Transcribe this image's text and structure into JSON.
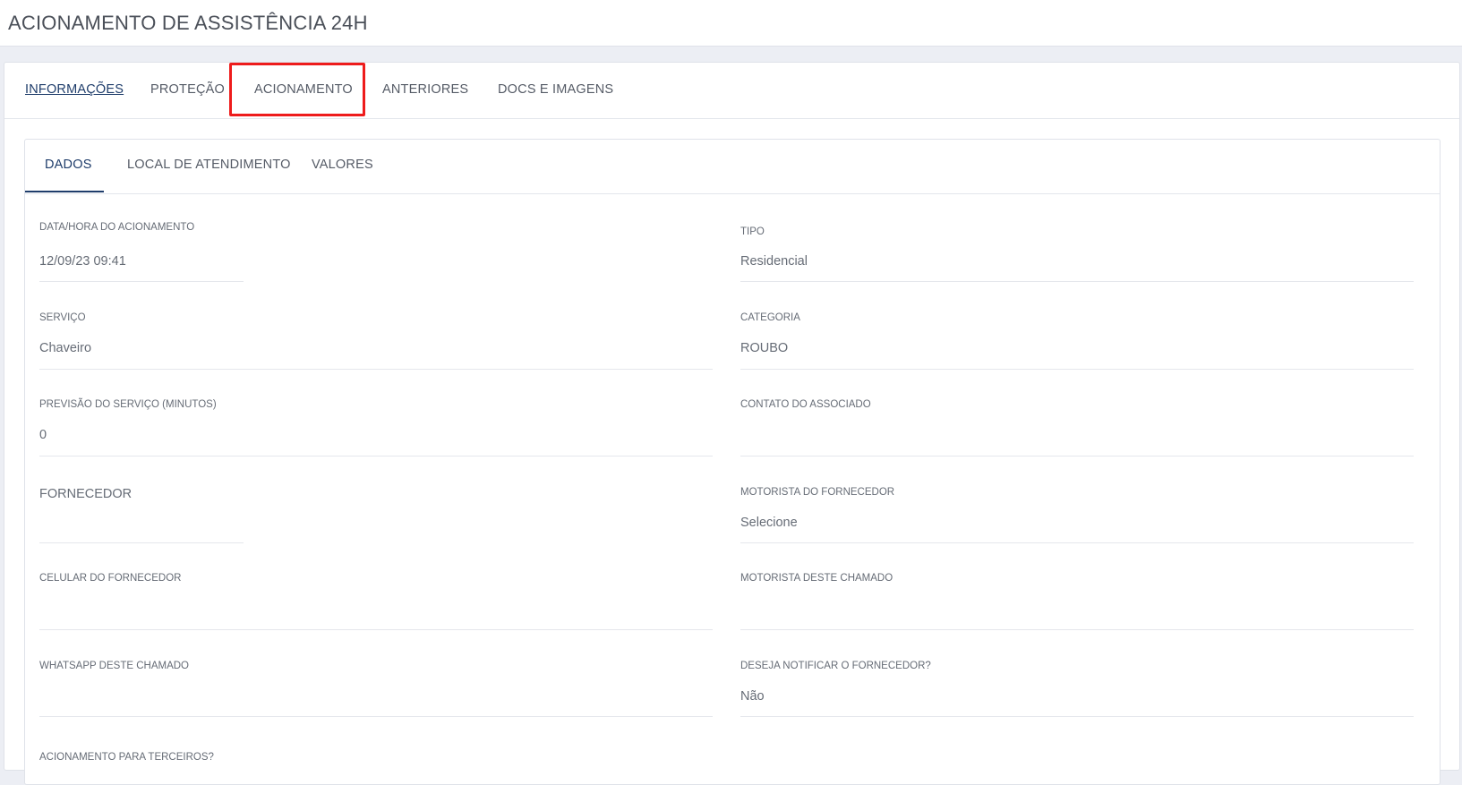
{
  "page": {
    "title": "ACIONAMENTO DE ASSISTÊNCIA 24H"
  },
  "top_tabs": [
    {
      "label": "INFORMAÇÕES",
      "active": true
    },
    {
      "label": "PROTEÇÃO"
    },
    {
      "label": "ACIONAMENTO",
      "highlighted": true
    },
    {
      "label": "ANTERIORES"
    },
    {
      "label": "DOCS E IMAGENS"
    }
  ],
  "sub_tabs": [
    {
      "label": "DADOS",
      "active": true
    },
    {
      "label": "LOCAL DE ATENDIMENTO"
    },
    {
      "label": "VALORES"
    }
  ],
  "fields": {
    "data_hora": {
      "label": "DATA/HORA DO ACIONAMENTO",
      "value": "12/09/23 09:41"
    },
    "tipo": {
      "label": "TIPO",
      "value": "Residencial"
    },
    "servico": {
      "label": "SERVIÇO",
      "value": "Chaveiro"
    },
    "categoria": {
      "label": "CATEGORIA",
      "value": "ROUBO"
    },
    "previsao": {
      "label": "PREVISÃO DO SERVIÇO (MINUTOS)",
      "value": "0"
    },
    "contato": {
      "label": "CONTATO DO ASSOCIADO",
      "value": ""
    },
    "fornecedor": {
      "label": "FORNECEDOR",
      "value": ""
    },
    "motorista_fornecedor": {
      "label": "MOTORISTA DO FORNECEDOR",
      "value": "Selecione"
    },
    "celular_fornecedor": {
      "label": "CELULAR DO FORNECEDOR",
      "value": ""
    },
    "motorista_chamado": {
      "label": "MOTORISTA DESTE CHAMADO",
      "value": ""
    },
    "whatsapp": {
      "label": "WHATSAPP DESTE CHAMADO",
      "value": ""
    },
    "notificar": {
      "label": "DESEJA NOTIFICAR O FORNECEDOR?",
      "value": "Não"
    },
    "terceiros": {
      "label": "ACIONAMENTO PARA TERCEIROS?"
    }
  },
  "colors": {
    "accent": "#1f3d6b",
    "highlight": "#ee1c1c"
  }
}
